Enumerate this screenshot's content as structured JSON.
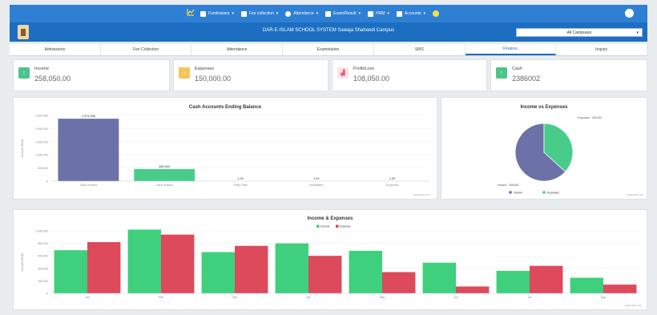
{
  "nav": {
    "items": [
      {
        "label": "Fundraisers",
        "icon": "wallet-icon"
      },
      {
        "label": "Fee collection",
        "icon": "user-icon"
      },
      {
        "label": "Attendance",
        "icon": "clock-icon"
      },
      {
        "label": "Exam/Result",
        "icon": "pencil-icon"
      },
      {
        "label": "HRM",
        "icon": "people-icon"
      },
      {
        "label": "Accounts",
        "icon": "money-icon"
      }
    ]
  },
  "header": {
    "title": "DAR-E-ISLAM SCHOOL SYSTEM Sawaja Shaheedi Campus",
    "campus_select": "All Campuses"
  },
  "tabs": [
    {
      "label": "Admissions"
    },
    {
      "label": "Fee Collection"
    },
    {
      "label": "Attendance"
    },
    {
      "label": "Examination"
    },
    {
      "label": "SMS"
    },
    {
      "label": "Finance",
      "active": true
    },
    {
      "label": "Inquiry"
    }
  ],
  "cards": [
    {
      "label": "Income",
      "value": "258,050.00",
      "color": "#4cc48a",
      "icon": "arrow-up-icon"
    },
    {
      "label": "Expenses",
      "value": "150,000.00",
      "color": "#f5c55a",
      "icon": "arrow-down-icon"
    },
    {
      "label": "Profit/Loss",
      "value": "108,050.00",
      "color": "#e65c76",
      "icon": "chart-icon"
    },
    {
      "label": "Cash",
      "value": "2386002",
      "color": "#4cc48a",
      "icon": "cash-icon"
    }
  ],
  "cash_title": "Cash Accounts Ending Balance",
  "pie_title": "Income vs Expenses",
  "bottom_title": "Income & Expenses",
  "credit_text": "Highcharts.com",
  "chart_data": [
    {
      "type": "bar",
      "title": "Cash Accounts Ending Balance",
      "ylabel": "Amount (PKR)",
      "categories": [
        "Cash in Hand",
        "Cash at Bank",
        "Petty Cash",
        "Investment",
        "Suspense"
      ],
      "values": [
        2374396,
        460000,
        1,
        1,
        1
      ],
      "data_labels": [
        "2,374,396",
        "460,000",
        "1.00",
        "1.00",
        "1.00"
      ],
      "yticks": [
        "2,500,000",
        "2,000,000",
        "1,500,000",
        "1,000,000",
        "500,000",
        "0"
      ],
      "ylim": [
        0,
        2500000
      ],
      "color": "#6b72a8",
      "color_alt": "#49cc8a"
    },
    {
      "type": "pie",
      "title": "Income vs Expenses",
      "labels": [
        "Income",
        "Expenses"
      ],
      "values": [
        258050,
        150000
      ],
      "slice_labels": [
        "Income : 258,050",
        "Expenses : 150,000"
      ],
      "legend": [
        "Income",
        "Expenses"
      ],
      "colors": [
        "#6b72a8",
        "#49cc8a"
      ]
    },
    {
      "type": "bar",
      "title": "Income & Expenses",
      "ylabel": "Amount (PKR)",
      "categories": [
        "Jan",
        "Feb",
        "Mar",
        "Apr",
        "May",
        "Jun",
        "Jul",
        "Aug"
      ],
      "series": [
        {
          "name": "Income",
          "values": [
            690000,
            1020000,
            660000,
            800000,
            680000,
            490000,
            360000,
            250000
          ],
          "color": "#3ed07c"
        },
        {
          "name": "Expense",
          "values": [
            820000,
            940000,
            760000,
            600000,
            340000,
            110000,
            440000,
            140000
          ],
          "color": "#dc4a5c"
        }
      ],
      "yticks": [
        "1,000,000",
        "800,000",
        "600,000",
        "400,000",
        "200,000",
        "0"
      ],
      "ylim": [
        0,
        1000000
      ]
    }
  ]
}
